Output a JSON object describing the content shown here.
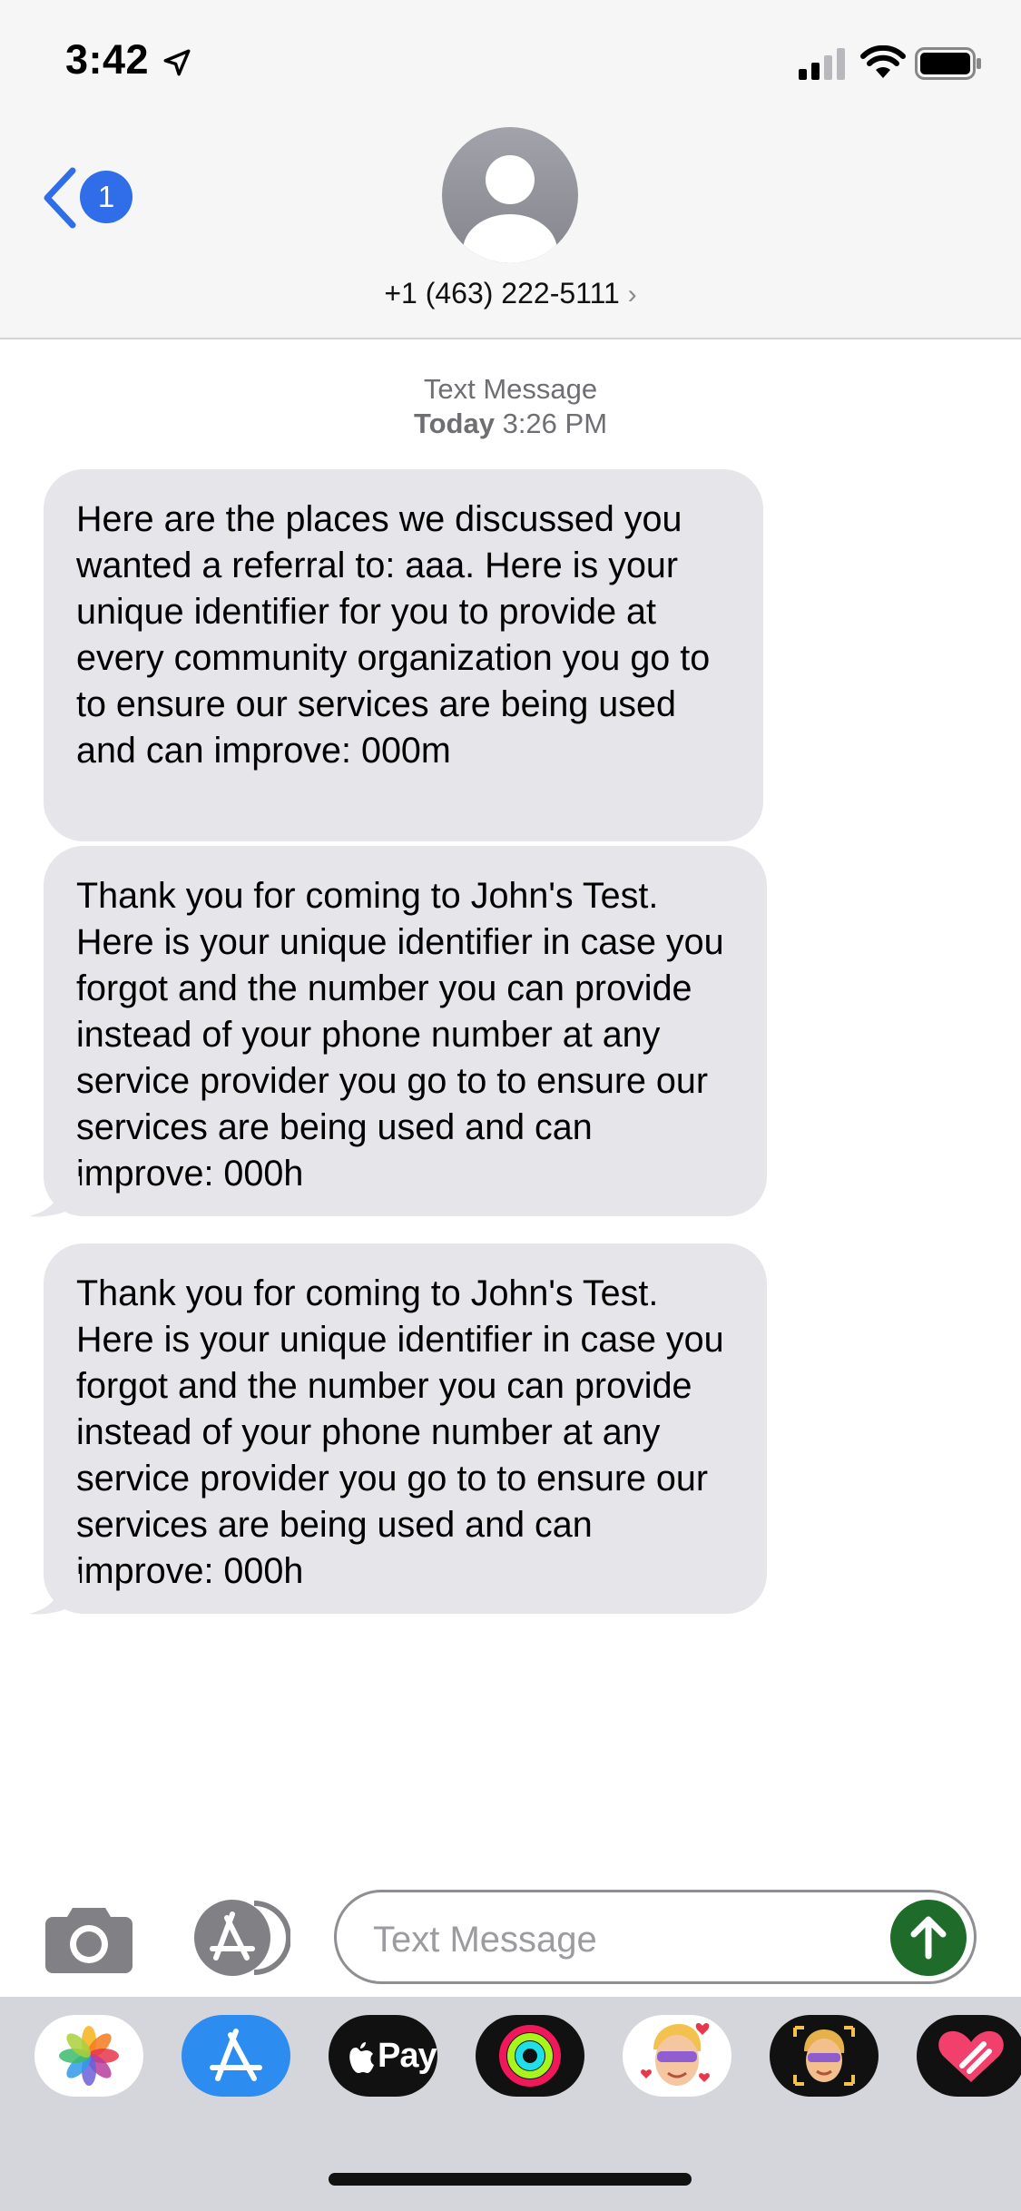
{
  "status_bar": {
    "time": "3:42"
  },
  "header": {
    "back_badge": "1",
    "contact": "+1 (463) 222-5111",
    "contact_chevron": "›"
  },
  "conversation": {
    "service": "Text Message",
    "day": "Today",
    "time": "3:26 PM",
    "messages": [
      {
        "text": "Here are the places we discussed you wanted a referral to: aaa. Here is your unique identifier for you to provide at every community organization you go to to ensure our services are being used and can improve: 000m"
      },
      {
        "text": "Thank you for coming to John's Test. Here is your unique identifier in case you forgot and the number you can provide instead of your phone number at any service provider you go to to ensure our services are being used and can improve: 000h"
      },
      {
        "text": "Thank you for coming to John's Test. Here is your unique identifier in case you forgot and the number you can provide instead of your phone number at any service provider you go to to ensure our services are being used and can improve: 000h"
      }
    ]
  },
  "input": {
    "placeholder": "Text Message"
  },
  "drawer": {
    "apple_pay_label": "Pay",
    "apps": [
      "photos-icon",
      "app-store-icon",
      "apple-pay-icon",
      "activity-icon",
      "memoji-stickers-icon",
      "animoji-icon",
      "digital-touch-icon"
    ]
  },
  "colors": {
    "bubble": "#e5e5ea",
    "accent_blue": "#2f6ee8",
    "send_green": "#1e6b2a",
    "header_bg": "#f6f6f6",
    "drawer_bg": "#d5d6db"
  }
}
